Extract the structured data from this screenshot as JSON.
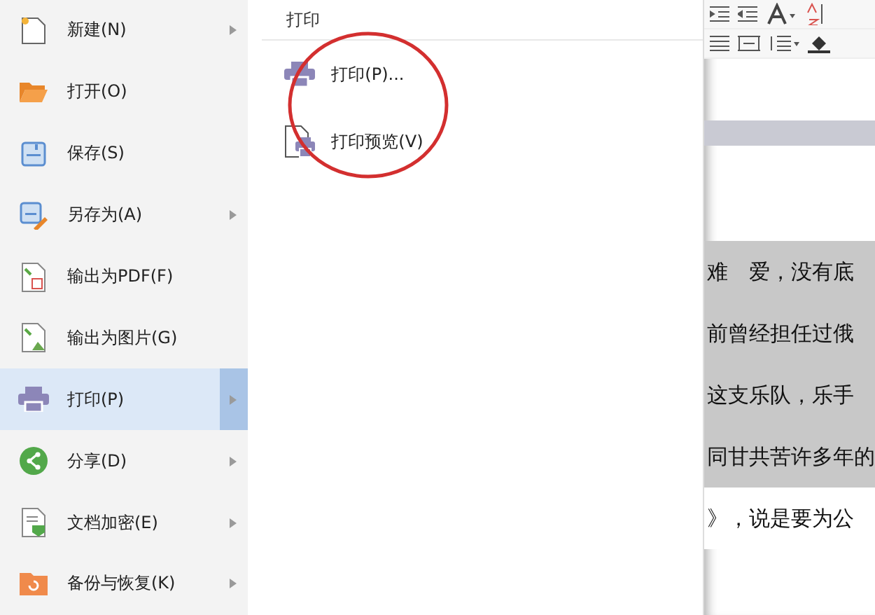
{
  "menu": {
    "items": [
      {
        "kind": "new",
        "label": "新建(N)",
        "has_submenu": true,
        "selected": false
      },
      {
        "kind": "open",
        "label": "打开(O)",
        "has_submenu": false,
        "selected": false
      },
      {
        "kind": "save",
        "label": "保存(S)",
        "has_submenu": false,
        "selected": false
      },
      {
        "kind": "saveas",
        "label": "另存为(A)",
        "has_submenu": true,
        "selected": false
      },
      {
        "kind": "pdf",
        "label": "输出为PDF(F)",
        "has_submenu": false,
        "selected": false
      },
      {
        "kind": "image",
        "label": "输出为图片(G)",
        "has_submenu": false,
        "selected": false
      },
      {
        "kind": "print",
        "label": "打印(P)",
        "has_submenu": true,
        "selected": true
      },
      {
        "kind": "share",
        "label": "分享(D)",
        "has_submenu": true,
        "selected": false
      },
      {
        "kind": "encrypt",
        "label": "文档加密(E)",
        "has_submenu": true,
        "selected": false
      },
      {
        "kind": "backup",
        "label": "备份与恢复(K)",
        "has_submenu": true,
        "selected": false
      }
    ]
  },
  "submenu": {
    "title": "打印",
    "items": [
      {
        "kind": "print",
        "label": "打印(P)..."
      },
      {
        "kind": "preview",
        "label": "打印预览(V)"
      }
    ]
  },
  "document": {
    "lines": [
      {
        "text": "难　爱，没有底",
        "highlighted": true
      },
      {
        "text": "前曾经担任过俄",
        "highlighted": true
      },
      {
        "text": "这支乐队，乐手",
        "highlighted": true
      },
      {
        "text": "同甘共苦许多年的",
        "highlighted": true
      },
      {
        "text": "》，说是要为公",
        "highlighted": false
      }
    ]
  }
}
